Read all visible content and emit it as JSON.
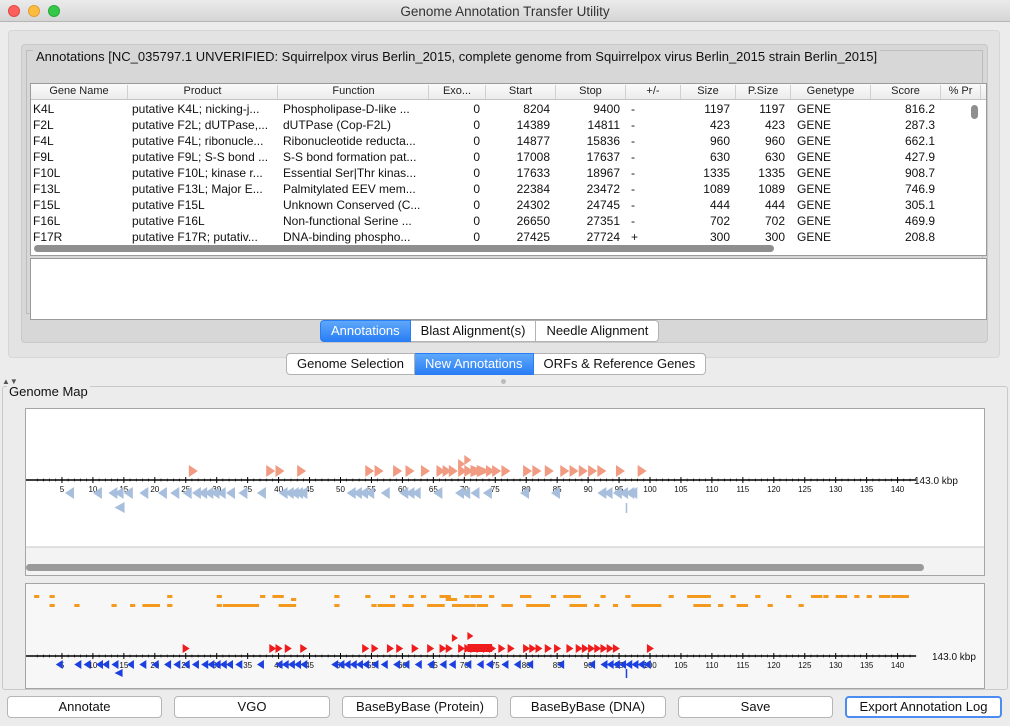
{
  "window": {
    "title": "Genome Annotation Transfer Utility"
  },
  "annotations_panel": {
    "legend": "Annotations [NC_035797.1 UNVERIFIED: Squirrelpox virus Berlin_2015, complete genome from Squirrelpox virus Berlin_2015 strain Berlin_2015]",
    "columns": [
      "Gene Name",
      "Product",
      "Function",
      "Exo...",
      "Start",
      "Stop",
      "+/-",
      "Size",
      "P.Size",
      "Genetype",
      "Score",
      "% Pr"
    ],
    "rows": [
      [
        "K4L",
        "putative K4L; nicking-j...",
        "Phospholipase-D-like ...",
        "0",
        "8204",
        "9400",
        "-",
        "1197",
        "1197",
        "GENE",
        "816.2"
      ],
      [
        "F2L",
        "putative F2L; dUTPase,...",
        "dUTPase (Cop-F2L)",
        "0",
        "14389",
        "14811",
        "-",
        "423",
        "423",
        "GENE",
        "287.3"
      ],
      [
        "F4L",
        "putative F4L; ribonucle...",
        "Ribonucleotide reducta...",
        "0",
        "14877",
        "15836",
        "-",
        "960",
        "960",
        "GENE",
        "662.1"
      ],
      [
        "F9L",
        "putative F9L; S-S bond ...",
        "S-S bond formation pat...",
        "0",
        "17008",
        "17637",
        "-",
        "630",
        "630",
        "GENE",
        "427.9"
      ],
      [
        "F10L",
        "putative F10L; kinase r...",
        "Essential Ser|Thr kinas...",
        "0",
        "17633",
        "18967",
        "-",
        "1335",
        "1335",
        "GENE",
        "908.7"
      ],
      [
        "F13L",
        "putative F13L; Major E...",
        "Palmitylated EEV mem...",
        "0",
        "22384",
        "23472",
        "-",
        "1089",
        "1089",
        "GENE",
        "746.9"
      ],
      [
        "F15L",
        "putative F15L",
        "Unknown Conserved (C...",
        "0",
        "24302",
        "24745",
        "-",
        "444",
        "444",
        "GENE",
        "305.1"
      ],
      [
        "F16L",
        "putative F16L",
        "Non-functional Serine ...",
        "0",
        "26650",
        "27351",
        "-",
        "702",
        "702",
        "GENE",
        "469.9"
      ],
      [
        "F17R",
        "putative F17R;  putativ...",
        "DNA-binding phospho...",
        "0",
        "27425",
        "27724",
        "+",
        "300",
        "300",
        "GENE",
        "208.8"
      ]
    ]
  },
  "tabs_top": [
    "Annotations",
    "Blast Alignment(s)",
    "Needle Alignment"
  ],
  "tabs_top_active": 0,
  "tabs_bottom": [
    "Genome Selection",
    "New Annotations",
    "ORFs & Reference Genes"
  ],
  "tabs_bottom_active": 1,
  "genome_map": {
    "legend": "Genome Map",
    "length_label": "143.0 kbp",
    "length_kbp": 143,
    "ticks_kbp": [
      5,
      10,
      15,
      20,
      25,
      30,
      35,
      40,
      45,
      50,
      55,
      60,
      65,
      70,
      75,
      80,
      85,
      90,
      95,
      100,
      105,
      110,
      115,
      120,
      125,
      130,
      135,
      140
    ],
    "colors": {
      "forward_genes": "#f09b82",
      "reverse_genes": "#a7bfdc",
      "forward_orfs": "#ee1c1c",
      "reverse_orfs": "#1c3fe0",
      "track_orange": "#f39a1e"
    },
    "forward_genes_kbp": [
      25.5,
      38.0,
      39.5,
      43.0,
      54.0,
      55.5,
      58.5,
      60.5,
      63.0,
      65.5,
      66.5,
      67.5,
      69.0,
      70.0,
      71.0,
      72.0,
      73.5,
      74.5,
      76.0,
      79.5,
      81.0,
      83.0,
      85.5,
      87.0,
      88.5,
      90.0,
      91.5,
      94.5,
      98.0
    ],
    "reverse_genes_kbp": [
      5.5,
      10.0,
      12.5,
      13.5,
      15.0,
      17.5,
      20.5,
      22.5,
      24.5,
      26.0,
      27.0,
      28.0,
      29.0,
      30.0,
      31.5,
      33.5,
      36.5,
      40.0,
      41.0,
      41.8,
      42.5,
      43.2,
      51.0,
      52.0,
      53.0,
      54.0,
      56.5,
      59.5,
      60.5,
      61.5,
      65.0,
      68.5,
      69.5,
      71.0,
      73.0,
      79.0,
      84.0,
      91.5,
      92.5,
      94.0,
      95.0,
      96.0,
      96.5
    ],
    "orf_forward_kbp": [
      24.5,
      38.5,
      39.5,
      41.0,
      43.5,
      53.5,
      55.0,
      57.5,
      59.0,
      61.5,
      64.0,
      66.0,
      67.0,
      69.0,
      70.0,
      71.0,
      72.0,
      73.0,
      74.0,
      75.5,
      77.0,
      79.5,
      80.5,
      81.5,
      83.0,
      84.5,
      86.5,
      88.0,
      89.0,
      90.0,
      91.0,
      92.0,
      93.0,
      94.0,
      99.5
    ],
    "orf_reverse_kbp": [
      4.0,
      7.0,
      8.5,
      10.5,
      11.5,
      13.0,
      15.5,
      17.5,
      19.5,
      21.5,
      23.0,
      24.5,
      26.0,
      27.5,
      28.5,
      29.5,
      30.5,
      31.5,
      33.0,
      36.5,
      39.5,
      40.5,
      41.5,
      42.5,
      43.5,
      48.5,
      49.5,
      50.5,
      51.5,
      52.5,
      53.5,
      55.0,
      56.5,
      58.5,
      60.0,
      62.0,
      64.0,
      66.0,
      67.5,
      70.0,
      72.0,
      73.5,
      76.0,
      78.0,
      80.0,
      85.0,
      90.0,
      92.0,
      93.0,
      94.0,
      95.0,
      96.0,
      97.0,
      98.0,
      99.0
    ]
  },
  "buttons": [
    "Annotate",
    "VGO",
    "BaseByBase (Protein)",
    "BaseByBase (DNA)",
    "Save",
    "Export Annotation Log"
  ]
}
